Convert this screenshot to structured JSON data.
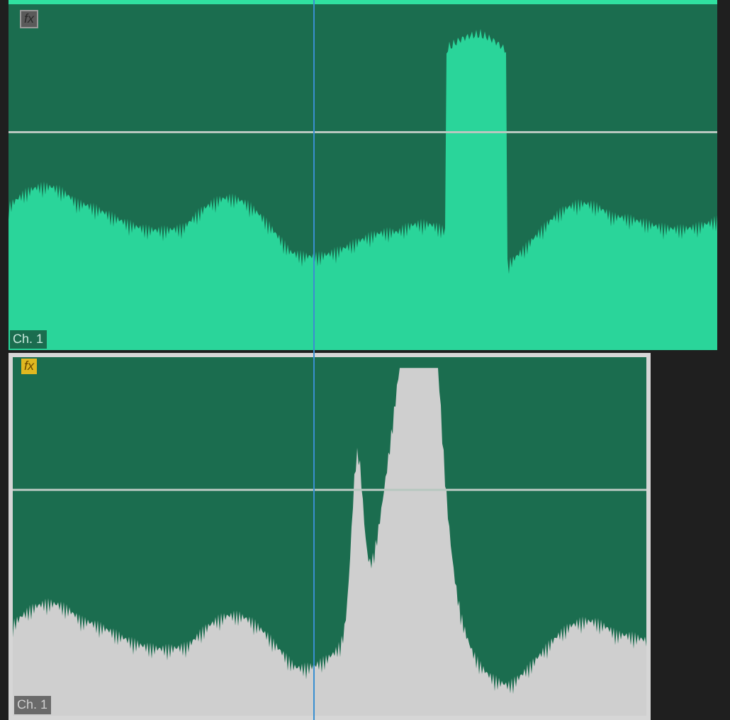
{
  "clips": [
    {
      "fx_label": "fx",
      "fx_enabled": false,
      "selected": false,
      "channel_label": "Ch. 1"
    },
    {
      "fx_label": "fx",
      "fx_enabled": true,
      "selected": true,
      "channel_label": "Ch. 1"
    }
  ]
}
